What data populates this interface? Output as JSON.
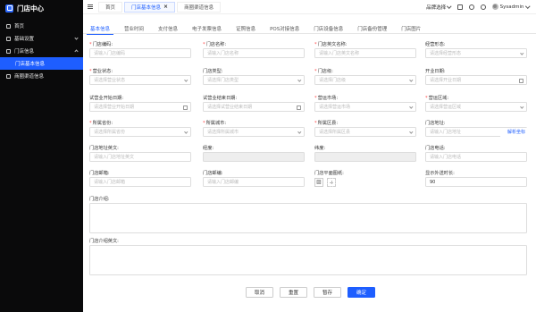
{
  "app": {
    "title": "门店中心"
  },
  "sidebar": {
    "items": [
      {
        "label": "首页"
      },
      {
        "label": "基础设置"
      },
      {
        "label": "门店信息"
      },
      {
        "label": "门店基本信息"
      },
      {
        "label": "商圈渠道信息"
      }
    ]
  },
  "topbar": {
    "tabs": [
      {
        "label": "首页"
      },
      {
        "label": "门店基本信息"
      },
      {
        "label": "商圈渠道信息"
      }
    ],
    "org_select": "品牌选择",
    "username": "Sysadmin"
  },
  "subtabs": [
    "基本信息",
    "营业时间",
    "支付信息",
    "电子发票信息",
    "证照信息",
    "POS对接信息",
    "门店设备信息",
    "门店备份管理",
    "门店图片"
  ],
  "form": {
    "store_code": {
      "label": "门店编码:",
      "placeholder": "请输入门店编码"
    },
    "store_name": {
      "label": "门店名称:",
      "placeholder": "请输入门店名称"
    },
    "store_name_en": {
      "label": "门店英文名称:",
      "placeholder": "请输入门店英文名称"
    },
    "business_form": {
      "label": "经营形态:",
      "placeholder": "请选择经营形态"
    },
    "business_status": {
      "label": "营业状态:",
      "placeholder": "请选择营业状态"
    },
    "store_type": {
      "label": "门店类型:",
      "placeholder": "请选择门店类型"
    },
    "store_level": {
      "label": "门店级:",
      "placeholder": "请选择门店级"
    },
    "open_date": {
      "label": "开业日期:",
      "placeholder": "请选择开业日期"
    },
    "trial_start": {
      "label": "试营业开始日期:",
      "placeholder": "请选择营业开始日期"
    },
    "trial_end": {
      "label": "试营业结束日期:",
      "placeholder": "请选择试营业结束日期"
    },
    "market": {
      "label": "营运市场:",
      "placeholder": "请选择营运市场"
    },
    "region": {
      "label": "营运区域:",
      "placeholder": "请选择营运区域"
    },
    "province": {
      "label": "所属省份:",
      "placeholder": "请选择所属省份"
    },
    "city": {
      "label": "所属城市:",
      "placeholder": "请选择所属城市"
    },
    "district": {
      "label": "所属区县:",
      "placeholder": "请选择所属区县"
    },
    "address": {
      "label": "门店地址:",
      "placeholder": "请输入门店地址",
      "link": "解析坐标"
    },
    "address_en": {
      "label": "门店地址英文:",
      "placeholder": "请输入门店地址英文"
    },
    "longitude": {
      "label": "经度:",
      "placeholder": ""
    },
    "latitude": {
      "label": "纬度:",
      "placeholder": ""
    },
    "phone": {
      "label": "门店电话:",
      "placeholder": "请输入门店电话"
    },
    "email": {
      "label": "门店邮箱:",
      "placeholder": "请输入门店邮箱"
    },
    "postcode": {
      "label": "门店邮编:",
      "placeholder": "请输入门店邮编"
    },
    "floorplan": {
      "label": "门店平面图纸:"
    },
    "delivery_time": {
      "label": "显示外送时长:",
      "value": "90"
    },
    "intro": {
      "label": "门店介绍:"
    },
    "intro_en": {
      "label": "门店介绍英文:"
    }
  },
  "buttons": {
    "cancel": "取消",
    "reset": "重置",
    "save_draft": "暂存",
    "confirm": "确定"
  },
  "colors": {
    "accent": "#1e5eff",
    "sidebar_bg": "#0a0a0b",
    "required": "#ff4444"
  }
}
